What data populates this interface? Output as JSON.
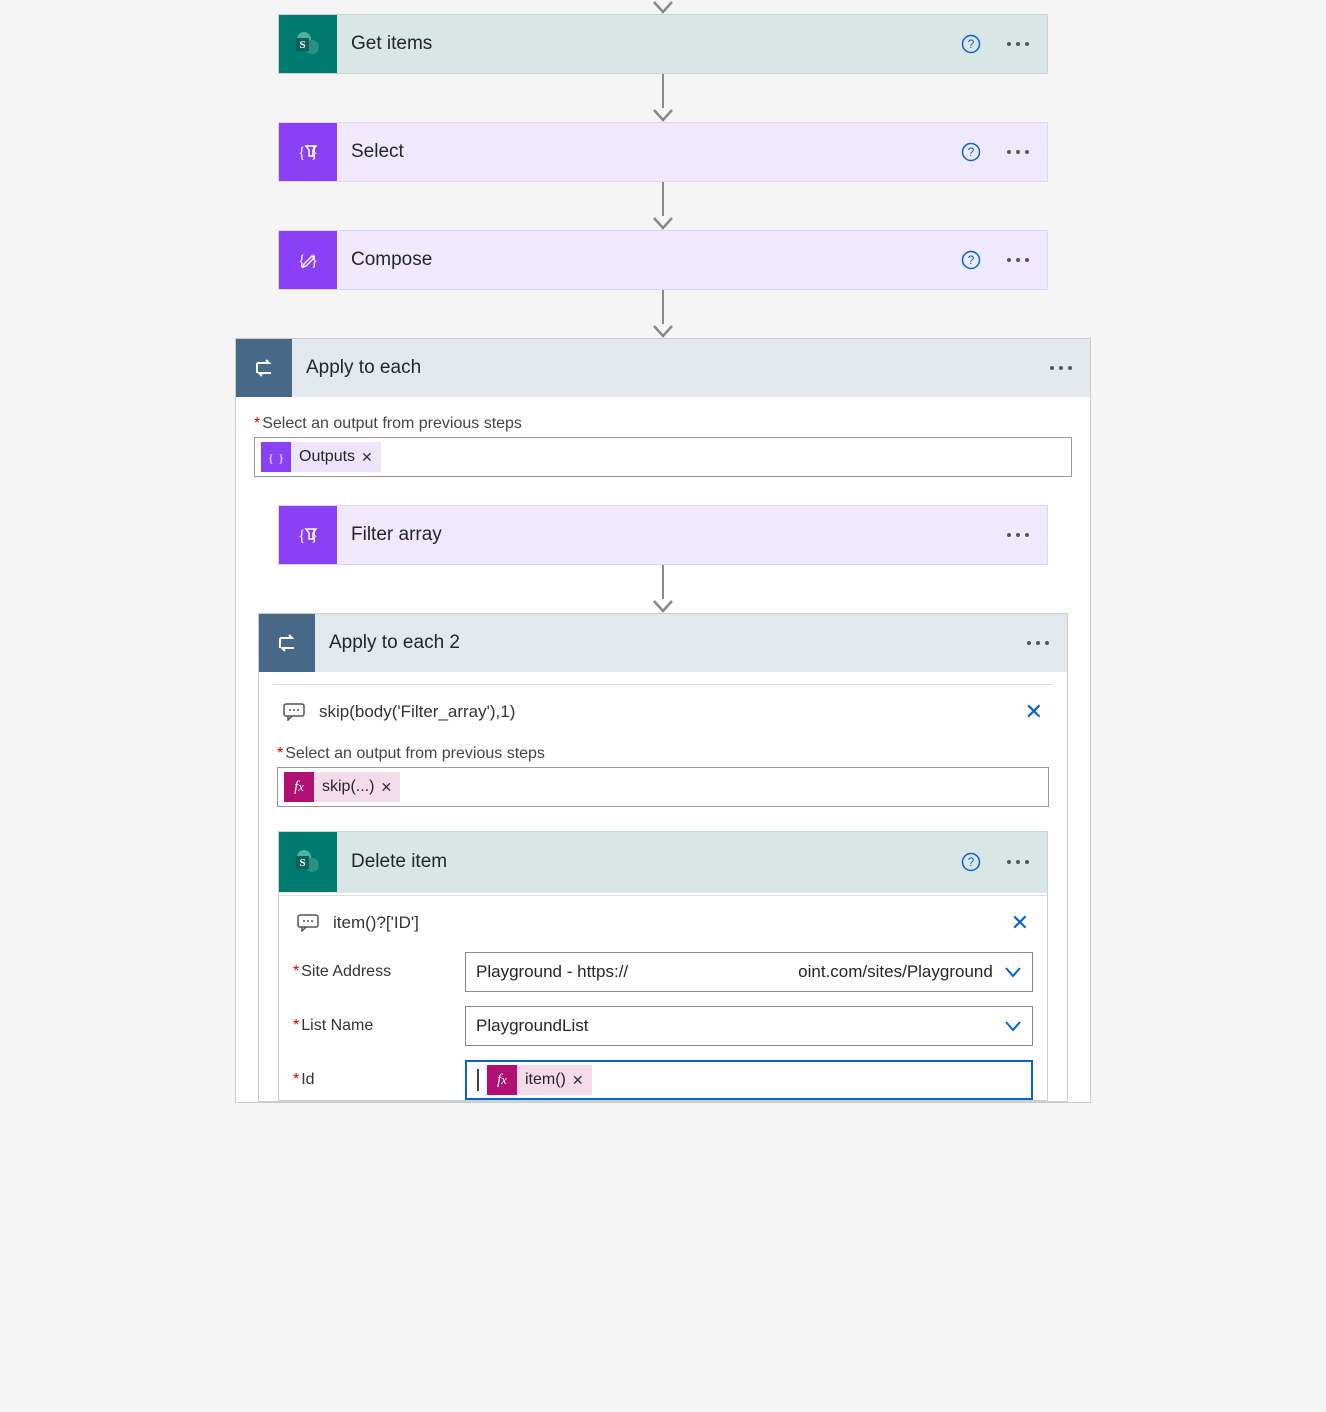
{
  "steps": {
    "get_items": "Get items",
    "select": "Select",
    "compose": "Compose",
    "filter_array": "Filter array",
    "apply_each": "Apply to each",
    "apply_each2": "Apply to each 2",
    "delete_item": "Delete item"
  },
  "labels": {
    "select_output": "Select an output from previous steps"
  },
  "tokens": {
    "outputs": "Outputs",
    "skip_short": "skip(...)",
    "item_fx": "item()"
  },
  "comments": {
    "skip_expr": "skip(body('Filter_array'),1)",
    "item_id_expr": "item()?['ID']"
  },
  "delete_params": {
    "site_address_label": "Site Address",
    "site_address_value": "Playground - https://                                    oint.com/sites/Playground",
    "list_name_label": "List Name",
    "list_name_value": "PlaygroundList",
    "id_label": "Id"
  }
}
